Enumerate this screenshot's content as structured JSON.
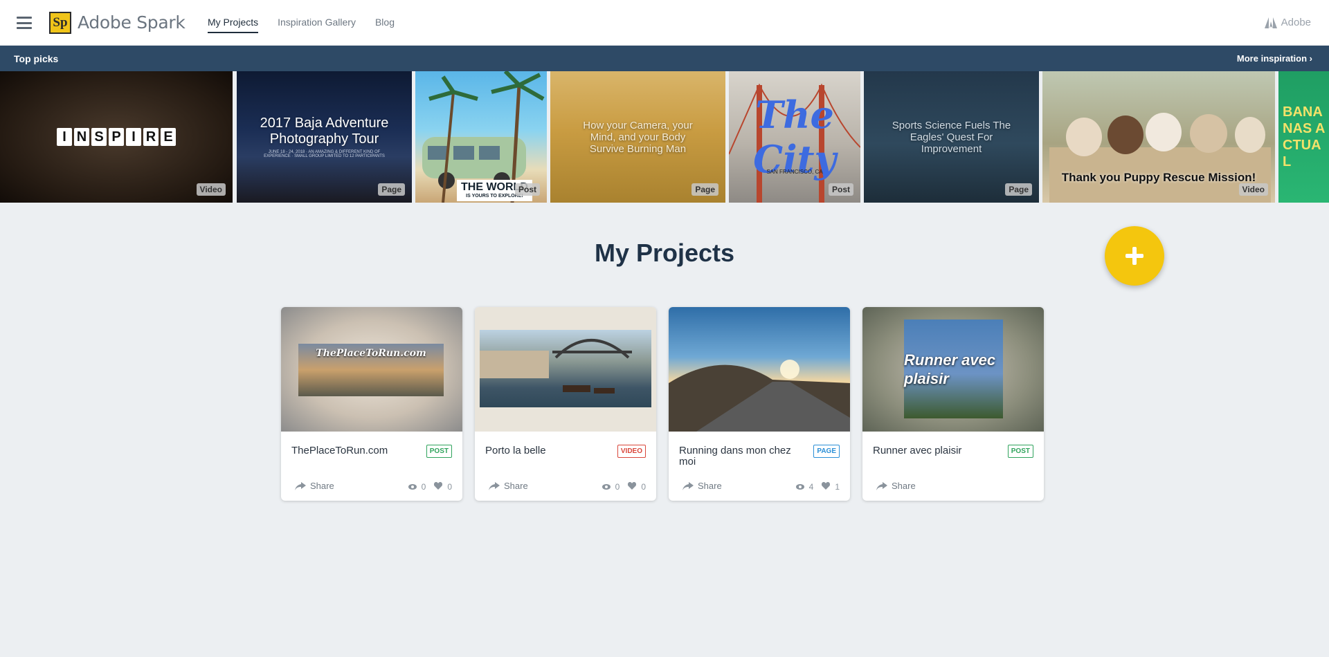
{
  "app": {
    "name": "Adobe Spark",
    "logo_mark": "Sp",
    "brand_right": "Adobe"
  },
  "nav": {
    "items": [
      "My Projects",
      "Inspiration Gallery",
      "Blog"
    ],
    "active": "My Projects"
  },
  "top_picks": {
    "title": "Top picks",
    "more_label": "More inspiration",
    "more_chevron": "›",
    "tiles": [
      {
        "title": "INSPIRE",
        "letters": [
          "I",
          "N",
          "S",
          "P",
          "I",
          "R",
          "E"
        ],
        "type": "Video"
      },
      {
        "title": "2017 Baja Adventure Photography Tour",
        "subtitle": "JUNE 18 - 24, 2018 · AN AMAZING & DIFFERENT KIND OF EXPERIENCE · SMALL GROUP LIMITED TO 12 PARTICIPANTS",
        "type": "Page"
      },
      {
        "title": "THE WORLD",
        "subtitle": "IS YOURS TO EXPLORE!",
        "type": "Post"
      },
      {
        "title": "How your Camera, your Mind, and your Body Survive Burning Man",
        "type": "Page"
      },
      {
        "title": "The City",
        "subtitle": "SAN FRANCISCO, CA",
        "type": "Post"
      },
      {
        "title": "Sports Science Fuels The Eagles' Quest For Improvement",
        "type": "Page"
      },
      {
        "title": "Thank you Puppy Rescue Mission!",
        "type": "Video"
      },
      {
        "title": "BANANAS ACTUAL",
        "type": ""
      }
    ]
  },
  "main": {
    "title": "My Projects",
    "add_icon": "plus-icon",
    "share_label": "Share",
    "projects": [
      {
        "name": "ThePlaceToRun.com",
        "tag": "POST",
        "thumb_text": "ThePlaceToRun.com",
        "views": "0",
        "likes": "0"
      },
      {
        "name": "Porto la belle",
        "tag": "VIDEO",
        "thumb_text": "",
        "views": "0",
        "likes": "0"
      },
      {
        "name": "Running dans mon chez moi",
        "tag": "PAGE",
        "thumb_text": "",
        "views": "4",
        "likes": "1"
      },
      {
        "name": "Runner avec plaisir",
        "tag": "POST",
        "thumb_text": "Runner avec plaisir",
        "views": "",
        "likes": ""
      }
    ]
  },
  "colors": {
    "accent": "#f4c60e",
    "topbar": "#2e4a66",
    "post": "#2fa35c",
    "video": "#d9463a",
    "page": "#2b8fd6"
  }
}
